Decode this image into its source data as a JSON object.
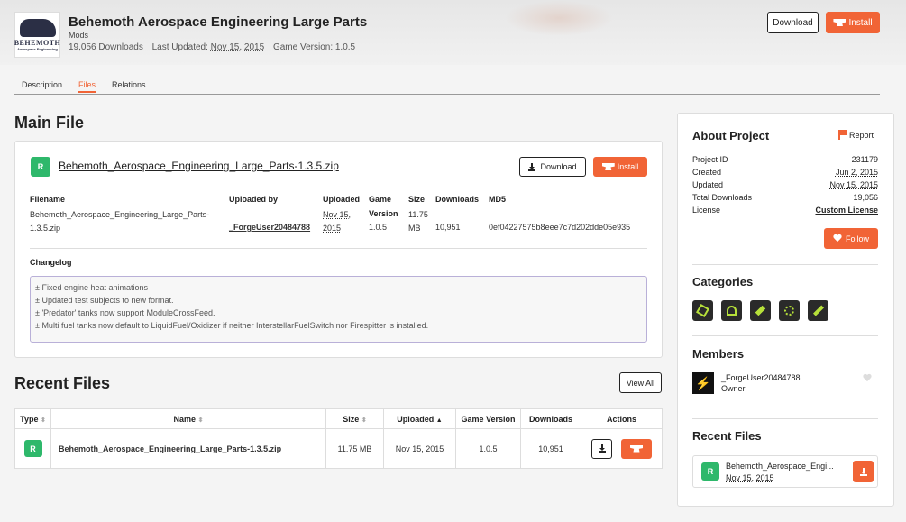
{
  "project": {
    "title": "Behemoth Aerospace Engineering Large Parts",
    "category": "Mods",
    "logo_text": "BEHEMOTH",
    "logo_subtext": "Aerospace Engineering",
    "downloads": "19,056 Downloads",
    "last_updated_label": "Last Updated:",
    "last_updated": "Nov 15, 2015",
    "game_version": "Game Version: 1.0.5"
  },
  "header_buttons": {
    "download": "Download",
    "install": "Install"
  },
  "tabs": [
    {
      "label": "Description"
    },
    {
      "label": "Files",
      "active": true
    },
    {
      "label": "Relations"
    }
  ],
  "main_file": {
    "heading": "Main File",
    "release_type": "R",
    "file_name": "Behemoth_Aerospace_Engineering_Large_Parts-1.3.5.zip",
    "download_label": "Download",
    "install_label": "Install",
    "headers": {
      "filename": "Filename",
      "uploaded_by": "Uploaded by",
      "uploaded": "Uploaded",
      "game_version": "Game Version",
      "size": "Size",
      "downloads": "Downloads",
      "md5": "MD5"
    },
    "filename_line1": "Behemoth_Aerospace_Engineering_Large_Parts-",
    "filename_line2": "1.3.5.zip",
    "uploaded_by": "_ForgeUser20484788",
    "uploaded_line1": "Nov 15,",
    "uploaded_line2": "2015",
    "game_version": "1.0.5",
    "size_line1": "11.75",
    "size_line2": "MB",
    "downloads": "10,951",
    "md5": "0ef04227575b8eee7c7d202dde05e935",
    "changelog_heading": "Changelog",
    "changelog": [
      "± Fixed engine heat animations",
      "± Updated test subjects to new format.",
      "± 'Predator' tanks now support ModuleCrossFeed.",
      "± Multi fuel tanks now default to LiquidFuel/Oxidizer if neither InterstellarFuelSwitch nor Firespitter is installed."
    ]
  },
  "recent_files": {
    "heading": "Recent Files",
    "view_all": "View All",
    "columns": {
      "type": "Type",
      "name": "Name",
      "size": "Size",
      "uploaded": "Uploaded",
      "game_version": "Game Version",
      "downloads": "Downloads",
      "actions": "Actions"
    },
    "rows": [
      {
        "type": "R",
        "name": "Behemoth_Aerospace_Engineering_Large_Parts-1.3.5.zip",
        "size": "11.75 MB",
        "uploaded": "Nov 15, 2015",
        "game_version": "1.0.5",
        "downloads": "10,951"
      }
    ]
  },
  "about": {
    "heading": "About Project",
    "report": "Report",
    "rows": [
      {
        "label": "Project ID",
        "value": "231179"
      },
      {
        "label": "Created",
        "value": "Jun 2, 2015"
      },
      {
        "label": "Updated",
        "value": "Nov 15, 2015"
      },
      {
        "label": "Total Downloads",
        "value": "19,056"
      },
      {
        "label": "License",
        "value": "Custom License"
      }
    ],
    "follow": "Follow"
  },
  "categories": {
    "heading": "Categories",
    "icons": [
      "cube-icon",
      "structural-icon",
      "fuel-tanks-icon",
      "parts-icon",
      "tweak-icon"
    ]
  },
  "members": {
    "heading": "Members",
    "name": "_ForgeUser20484788",
    "role": "Owner"
  },
  "side_recent": {
    "heading": "Recent Files",
    "type": "R",
    "name": "Behemoth_Aerospace_Engi...",
    "date": "Nov 15, 2015"
  },
  "colors": {
    "accent": "#f16436",
    "release": "#2eb86b",
    "category_icon": "#b6e03a"
  }
}
